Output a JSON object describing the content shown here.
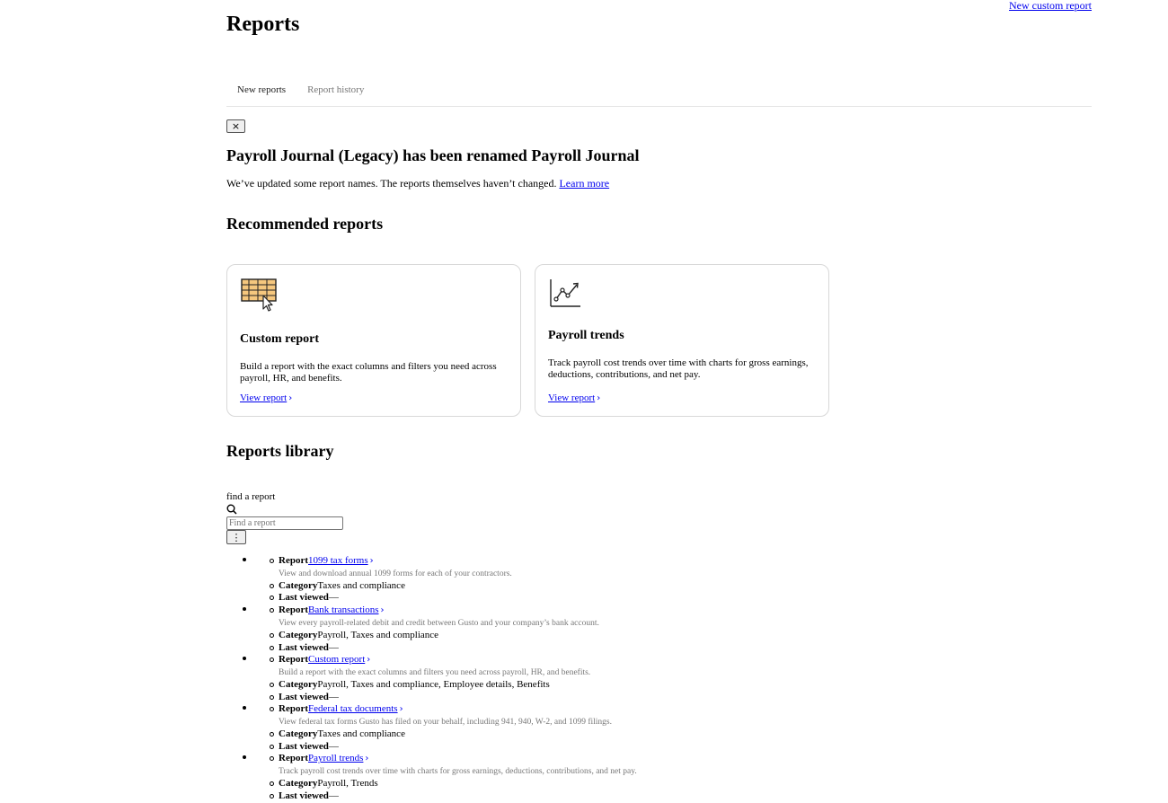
{
  "header": {
    "title": "Reports",
    "new_custom_report_link": "New custom report"
  },
  "tabs": [
    {
      "label": "New reports",
      "active": true
    },
    {
      "label": "Report history",
      "active": false
    }
  ],
  "banner": {
    "close_symbol": "×",
    "title": "Payroll Journal (Legacy) has been renamed Payroll Journal",
    "text": "We’ve updated some report names. The reports themselves haven’t changed.",
    "link": "Learn more"
  },
  "recommended": {
    "title": "Recommended reports",
    "cards": [
      {
        "icon": "spreadsheet-cursor-icon",
        "title": "Custom report",
        "description": "Build a report with the exact columns and filters you need across payroll, HR, and benefits.",
        "link": "View report"
      },
      {
        "icon": "line-chart-icon",
        "title": "Payroll trends",
        "description": "Track payroll cost trends over time with charts for gross earnings, deductions, contributions, and net pay.",
        "link": "View report"
      }
    ]
  },
  "library": {
    "title": "Reports library",
    "search_label": "find a report",
    "search_placeholder": "Find a report",
    "more_button": "⋮",
    "field_labels": {
      "report": "Report",
      "category": "Category",
      "last_viewed": "Last viewed"
    },
    "reports": [
      {
        "name": "1099 tax forms",
        "description": "View and download annual 1099 forms for each of your contractors.",
        "category": "Taxes and compliance",
        "last_viewed": "—"
      },
      {
        "name": "Bank transactions",
        "description": "View every payroll-related debit and credit between Gusto and your company’s bank account.",
        "category": "Payroll, Taxes and compliance",
        "last_viewed": "—"
      },
      {
        "name": "Custom report",
        "description": "Build a report with the exact columns and filters you need across payroll, HR, and benefits.",
        "category": "Payroll, Taxes and compliance, Employee details, Benefits",
        "last_viewed": "—"
      },
      {
        "name": "Federal tax documents",
        "description": "View federal tax forms Gusto has filed on your behalf, including 941, 940, W-2, and 1099 filings.",
        "category": "Taxes and compliance",
        "last_viewed": "—"
      },
      {
        "name": "Payroll trends",
        "description": "Track payroll cost trends over time with charts for gross earnings, deductions, contributions, and net pay.",
        "category": "Payroll, Trends",
        "last_viewed": "—"
      }
    ]
  },
  "colors": {
    "link": "#0000ee",
    "muted": "#777777",
    "card_border": "#d8d8d8",
    "icon_fill": "#f5c77e"
  }
}
